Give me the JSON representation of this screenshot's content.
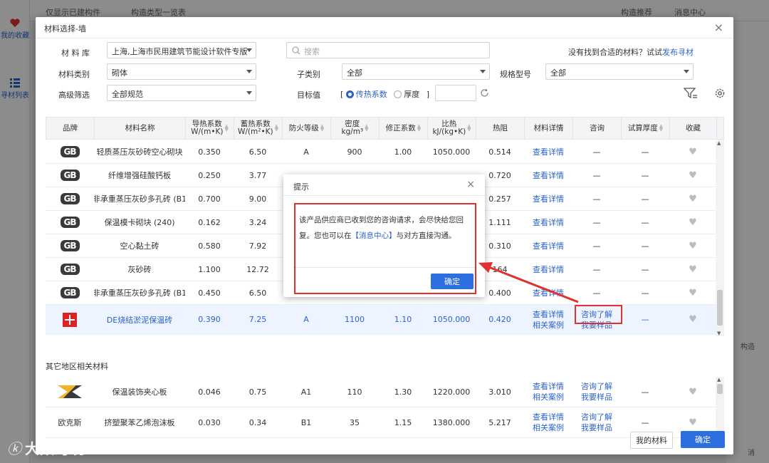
{
  "background": {
    "top_items": [
      "仅显示已建构件",
      "构造类型一览表",
      "构造推荐",
      "消息中心"
    ],
    "sidebar": [
      {
        "label": "我的收藏",
        "icon": "heart-icon"
      },
      {
        "label": "寻材列表",
        "icon": "list-icon"
      }
    ],
    "right_fragments": [
      "构造",
      "消"
    ]
  },
  "modal": {
    "title": "材料选择-墙",
    "close_glyph": "×",
    "filters": {
      "library_label": "材 料 库",
      "library_value": "上海,上海市民用建筑节能设计软件专版",
      "category_label": "材料类别",
      "category_value": "砌体",
      "advanced_label": "高级筛选",
      "advanced_value": "全部规范",
      "search_placeholder": "搜索",
      "subcategory_label": "子类别",
      "subcategory_value": "全部",
      "spec_label": "规格型号",
      "spec_value": "全部",
      "target_label": "目标值",
      "bracket_open": "[",
      "bracket_close": "]",
      "radio_conductivity": "传热系数",
      "radio_thickness": "厚度",
      "not_found_text": "没有找到合适的材料？试试",
      "not_found_link": "发布寻材"
    },
    "table": {
      "headers": [
        "品牌",
        "材料名称",
        "导热系数\nW/(m•K)",
        "蓄热系数\nW/(m²•K)",
        "防火等级",
        "密度\nkg/m³",
        "修正系数",
        "比热\nkJ/(kg•K)",
        "热阻",
        "材料详情",
        "咨询",
        "试算厚度",
        "收藏"
      ],
      "rows": [
        {
          "brand": "GB",
          "name": "轻质蒸压灰砂砖空心砌块",
          "k": "0.350",
          "s": "6.50",
          "fire": "A",
          "density": "900",
          "corr": "1.00",
          "cp": "1050.000",
          "r": "0.514",
          "detail": "查看详情",
          "consult": "—",
          "calc": "—"
        },
        {
          "brand": "GB",
          "name": "纤维增强硅酸钙板",
          "k": "0.250",
          "s": "3.77",
          "fire": "",
          "density": "",
          "corr": "",
          "cp": "",
          "r": "0.720",
          "detail": "查看详情",
          "consult": "—",
          "calc": "—"
        },
        {
          "brand": "GB",
          "name": "非承重蒸压灰砂多孔砖 (B1",
          "k": "0.700",
          "s": "9.00",
          "fire": "",
          "density": "",
          "corr": "",
          "cp": "",
          "r": "0.257",
          "detail": "查看详情",
          "consult": "—",
          "calc": "—"
        },
        {
          "brand": "GB",
          "name": "保温模卡砌块 (240)",
          "k": "0.162",
          "s": "3.24",
          "fire": "",
          "density": "",
          "corr": "",
          "cp": "",
          "r": "1.111",
          "detail": "查看详情",
          "consult": "—",
          "calc": "—"
        },
        {
          "brand": "GB",
          "name": "空心黏土砖",
          "k": "0.580",
          "s": "7.92",
          "fire": "",
          "density": "",
          "corr": "",
          "cp": "",
          "r": "0.310",
          "detail": "查看详情",
          "consult": "—",
          "calc": "—"
        },
        {
          "brand": "GB",
          "name": "灰砂砖",
          "k": "1.100",
          "s": "12.72",
          "fire": "",
          "density": "",
          "corr": "",
          "cp": "",
          "r": "164",
          "detail": "查看详情",
          "consult": "—",
          "calc": "—"
        },
        {
          "brand": "GB",
          "name": "非承重蒸压灰砂多孔砖 (B1",
          "k": "0.450",
          "s": "6.50",
          "fire": "",
          "density": "",
          "corr": "",
          "cp": "",
          "r": "0.400",
          "detail": "查看详情",
          "consult": "—",
          "calc": "—"
        }
      ],
      "highlight_row": {
        "name": "DE烧结淤泥保温砖",
        "k": "0.390",
        "s": "7.25",
        "fire": "A",
        "density": "1100",
        "corr": "1.10",
        "cp": "1050.000",
        "r": "0.420",
        "detail1": "查看详情",
        "detail2": "相关案例",
        "consult1": "咨询了解",
        "consult2": "我要样品",
        "calc": "—"
      },
      "section_title": "其它地区相关材料",
      "other_rows": [
        {
          "brand": "",
          "name": "保温装饰夹心板",
          "k": "0.046",
          "s": "0.75",
          "fire": "A1",
          "density": "110",
          "corr": "1.30",
          "cp": "1220.000",
          "r": "3.010",
          "detail1": "查看详情",
          "detail2": "相关案例",
          "consult1": "咨询了解",
          "consult2": "我要样品",
          "calc": "—"
        },
        {
          "brand": "欧克斯",
          "name": "挤塑聚苯乙烯泡沫板",
          "k": "0.030",
          "s": "0.34",
          "fire": "B1",
          "density": "35",
          "corr": "1.15",
          "cp": "1380.000",
          "r": "5.217",
          "detail1": "查看详情",
          "detail2": "相关案例",
          "consult1": "咨询了解",
          "consult2": "我要样品",
          "calc": "—"
        }
      ]
    },
    "buttons": {
      "my_materials": "我的材料",
      "confirm": "确定"
    }
  },
  "dialog": {
    "title": "提示",
    "close_glyph": "×",
    "message_part1": "该产品供应商已收到您的咨询请求，会尽快给您回复。您也可以在",
    "message_link": "【消息中心】",
    "message_part2": "与对方直接沟通。",
    "ok_label": "确定"
  },
  "watermark": {
    "mark": "ⓚ",
    "text": "大数跨境"
  },
  "colors": {
    "accent": "#2b63c9",
    "primary_button": "#2d6fe0",
    "annotation_red": "#e03030",
    "highlight_row": "#eef4ff"
  }
}
